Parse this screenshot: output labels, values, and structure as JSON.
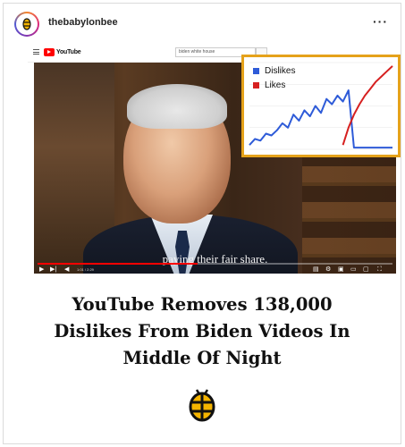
{
  "post": {
    "username": "thebabylonbee",
    "more_icon": "more-horizontal-icon",
    "more_label": "···"
  },
  "youtube": {
    "logo_text": "YouTube",
    "search_value": "biden white house",
    "caption": "paying their fair share.",
    "timecode": "1:01 / 2:29",
    "progress": 0.45
  },
  "chart_data": {
    "type": "line",
    "title": "",
    "xlabel": "",
    "ylabel": "",
    "series": [
      {
        "name": "Dislikes",
        "color": "#2e5bd8",
        "values": [
          0.05,
          0.12,
          0.1,
          0.18,
          0.16,
          0.22,
          0.3,
          0.25,
          0.4,
          0.33,
          0.45,
          0.38,
          0.5,
          0.42,
          0.58,
          0.52,
          0.62,
          0.55,
          0.68,
          0.02,
          0.02,
          0.02,
          0.02,
          0.02,
          0.02,
          0.02,
          0.02
        ]
      },
      {
        "name": "Likes",
        "color": "#d62020",
        "values": [
          null,
          null,
          null,
          null,
          null,
          null,
          null,
          null,
          null,
          null,
          null,
          null,
          null,
          null,
          null,
          null,
          null,
          0.05,
          0.25,
          0.4,
          0.52,
          0.62,
          0.7,
          0.78,
          0.84,
          0.9,
          0.96
        ]
      }
    ],
    "grid": true,
    "legend": "top-left",
    "border_color": "#e5a21b"
  },
  "headline": {
    "line1": "YouTube Removes 138,000",
    "line2": "Dislikes From Biden Videos In",
    "line3": "Middle Of Night"
  },
  "brand_logo": "babylon-bee-logo"
}
